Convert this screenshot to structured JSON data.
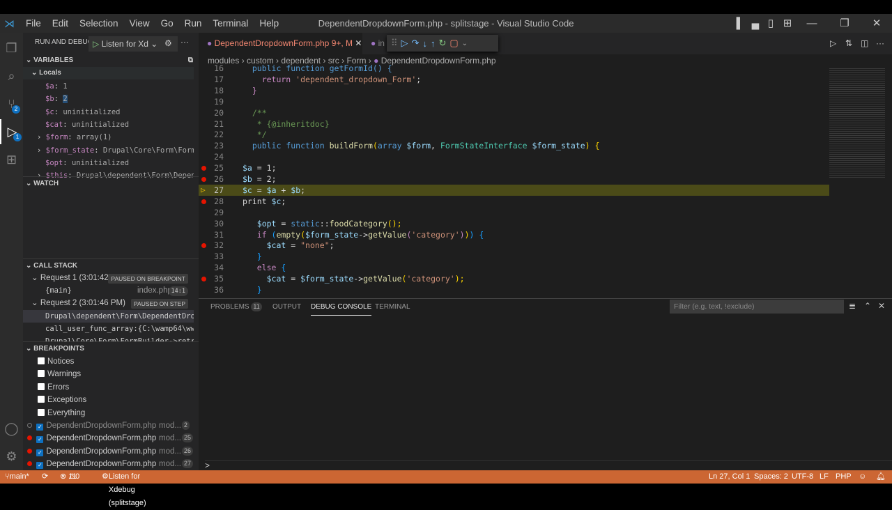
{
  "title": "DependentDropdownForm.php - splitstage - Visual Studio Code",
  "menu": [
    "File",
    "Edit",
    "Selection",
    "View",
    "Go",
    "Run",
    "Terminal",
    "Help"
  ],
  "activity": {
    "scm_badge": "2",
    "debug_badge": "1"
  },
  "run_debug": {
    "label": "RUN AND DEBUG",
    "config": "Listen for Xd"
  },
  "variables": {
    "header": "VARIABLES",
    "scope": "Locals",
    "items": [
      {
        "name": "$a",
        "value": "1"
      },
      {
        "name": "$b",
        "value": "2"
      },
      {
        "name": "$c",
        "value": "uninitialized"
      },
      {
        "name": "$cat",
        "value": "uninitialized"
      },
      {
        "name": "$form",
        "value": "array(1)"
      },
      {
        "name": "$form_state",
        "value": "Drupal\\Core\\Form\\FormS…"
      },
      {
        "name": "$opt",
        "value": "uninitialized"
      },
      {
        "name": "$this",
        "value": "Drupal\\dependent\\Form\\Depend…"
      }
    ]
  },
  "watch": {
    "header": "WATCH"
  },
  "callstack": {
    "header": "CALL STACK",
    "req1": {
      "label": "Request 1 (3:01:42 P...",
      "status": "PAUSED ON BREAKPOINT",
      "frame": "{main}",
      "file": "index.php",
      "pos": "14:1"
    },
    "req2": {
      "label": "Request 2 (3:01:46 PM)",
      "status": "PAUSED ON STEP",
      "frames": [
        "Drupal\\dependent\\Form\\DependentDropdo",
        "call_user_func_array:{C:\\wamp64\\www\\s",
        "Drupal\\Core\\Form\\FormBuilder->retrieve"
      ]
    }
  },
  "breakpoints": {
    "header": "BREAKPOINTS",
    "exceptions": [
      "Notices",
      "Warnings",
      "Errors",
      "Exceptions",
      "Everything"
    ],
    "files": [
      {
        "name": "DependentDropdownForm.php",
        "path": "mod...",
        "line": "2"
      },
      {
        "name": "DependentDropdownForm.php",
        "path": "mod...",
        "line": "25"
      },
      {
        "name": "DependentDropdownForm.php",
        "path": "mod...",
        "line": "26"
      },
      {
        "name": "DependentDropdownForm.php",
        "path": "mod...",
        "line": "27"
      }
    ]
  },
  "tabs": [
    {
      "label": "DependentDropdownForm.php",
      "status": "9+, M"
    },
    {
      "label": "in"
    }
  ],
  "breadcrumb": [
    "modules",
    "custom",
    "dependent",
    "src",
    "Form",
    "DependentDropdownForm.php"
  ],
  "code": [
    {
      "n": "16",
      "t": [
        [
          "  public function getFormId() {",
          "k"
        ]
      ]
    },
    {
      "n": "17",
      "t": [
        [
          "    return ",
          "p"
        ],
        [
          "'dependent_dropdown_Form'",
          "s"
        ],
        [
          ";",
          "w"
        ]
      ]
    },
    {
      "n": "18",
      "t": [
        [
          "  }",
          "p"
        ]
      ]
    },
    {
      "n": "19",
      "t": []
    },
    {
      "n": "20",
      "t": [
        [
          "  /**",
          "c"
        ]
      ]
    },
    {
      "n": "21",
      "t": [
        [
          "   * {@inheritdoc}",
          "c"
        ]
      ]
    },
    {
      "n": "22",
      "t": [
        [
          "   */",
          "c"
        ]
      ]
    },
    {
      "n": "23",
      "t": [
        [
          "  public function ",
          "k"
        ],
        [
          "buildForm",
          "f"
        ],
        [
          "(",
          "y"
        ],
        [
          "array ",
          "k"
        ],
        [
          "$form",
          "v"
        ],
        [
          ", ",
          "w"
        ],
        [
          "FormStateInterface ",
          "t"
        ],
        [
          "$form_state",
          "v"
        ],
        [
          ") {",
          "y"
        ]
      ]
    },
    {
      "n": "24",
      "t": []
    },
    {
      "n": "25",
      "bp": true,
      "t": [
        [
          "$a",
          "v"
        ],
        [
          " = ",
          "w"
        ],
        [
          "1",
          "w"
        ],
        [
          ";",
          "w"
        ]
      ]
    },
    {
      "n": "26",
      "bp": true,
      "t": [
        [
          "$b",
          "v"
        ],
        [
          " = ",
          "w"
        ],
        [
          "2",
          "w"
        ],
        [
          ";",
          "w"
        ]
      ]
    },
    {
      "n": "27",
      "cur": true,
      "t": [
        [
          "$c",
          "v"
        ],
        [
          " = ",
          "w"
        ],
        [
          "$a",
          "v"
        ],
        [
          " + ",
          "w"
        ],
        [
          "$b",
          "v"
        ],
        [
          ";",
          "w"
        ]
      ]
    },
    {
      "n": "28",
      "bp": true,
      "t": [
        [
          "print ",
          "w"
        ],
        [
          "$c",
          "v"
        ],
        [
          ";",
          "w"
        ]
      ]
    },
    {
      "n": "29",
      "t": []
    },
    {
      "n": "30",
      "t": [
        [
          "   $opt",
          "v"
        ],
        [
          " = ",
          "w"
        ],
        [
          "static",
          "k"
        ],
        [
          "::",
          "w"
        ],
        [
          "foodCategory",
          "f"
        ],
        [
          "();",
          "y"
        ]
      ]
    },
    {
      "n": "31",
      "t": [
        [
          "   if ",
          "p"
        ],
        [
          "(",
          "b"
        ],
        [
          "empty",
          "f"
        ],
        [
          "(",
          "y"
        ],
        [
          "$form_state",
          "v"
        ],
        [
          "->",
          "w"
        ],
        [
          "getValue",
          "f"
        ],
        [
          "(",
          "p"
        ],
        [
          "'category'",
          "s"
        ],
        [
          ")",
          "p"
        ],
        [
          ")",
          "y"
        ],
        [
          ") {",
          "b"
        ]
      ]
    },
    {
      "n": "32",
      "bp": true,
      "t": [
        [
          "     $cat",
          "v"
        ],
        [
          " = ",
          "w"
        ],
        [
          "\"none\"",
          "s"
        ],
        [
          ";",
          "w"
        ]
      ]
    },
    {
      "n": "33",
      "t": [
        [
          "   }",
          "b"
        ]
      ]
    },
    {
      "n": "34",
      "t": [
        [
          "   else ",
          "p"
        ],
        [
          "{",
          "b"
        ]
      ]
    },
    {
      "n": "35",
      "bp": true,
      "t": [
        [
          "     $cat",
          "v"
        ],
        [
          " = ",
          "w"
        ],
        [
          "$form_state",
          "v"
        ],
        [
          "->",
          "w"
        ],
        [
          "getValue",
          "f"
        ],
        [
          "(",
          "y"
        ],
        [
          "'category'",
          "s"
        ],
        [
          ");",
          "y"
        ]
      ]
    },
    {
      "n": "36",
      "t": [
        [
          "   }",
          "b"
        ]
      ]
    }
  ],
  "panel": {
    "tabs": [
      "PROBLEMS",
      "OUTPUT",
      "DEBUG CONSOLE",
      "TERMINAL"
    ],
    "problems_count": "11",
    "filter_placeholder": "Filter (e.g. text, !exclude)",
    "prompt": ">"
  },
  "status": {
    "branch": "main*",
    "errors": "11",
    "warnings": "0",
    "debug": "Listen for Xdebug (splitstage)",
    "position": "Ln 27, Col 1",
    "spaces": "Spaces: 2",
    "encoding": "UTF-8",
    "eol": "LF",
    "language": "PHP"
  },
  "colors": {
    "statusbar": "#cc6633",
    "accent": "#0e70c0",
    "breakpoint": "#e51400"
  }
}
